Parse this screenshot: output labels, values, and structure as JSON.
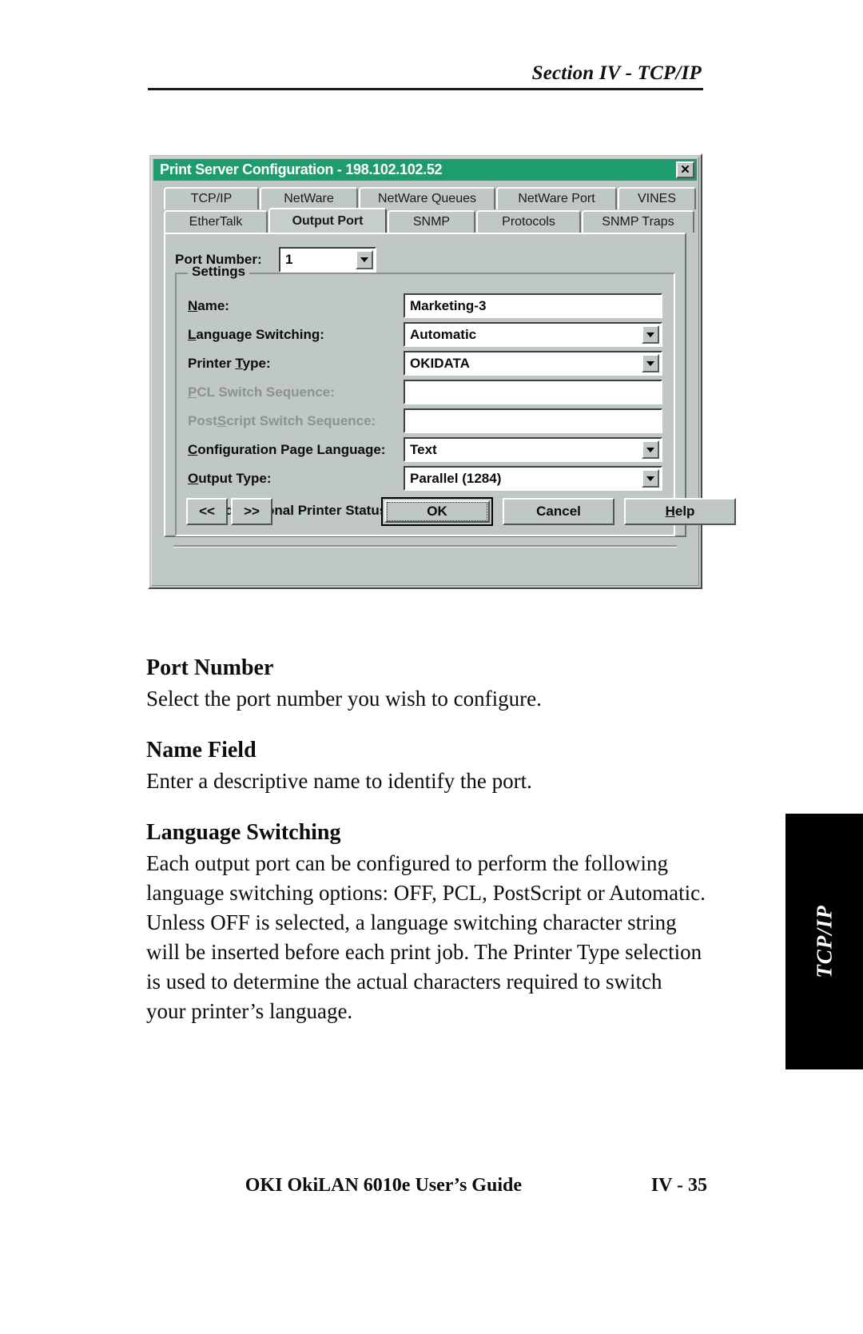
{
  "header": {
    "section": "Section IV - TCP/IP"
  },
  "dialog": {
    "title": "Print Server Configuration - 198.102.102.52",
    "close_label": "✕",
    "tabs_row1": [
      {
        "label": "TCP/IP",
        "active": false
      },
      {
        "label": "NetWare",
        "active": false
      },
      {
        "label": "NetWare Queues",
        "active": false
      },
      {
        "label": "NetWare Port",
        "active": false
      },
      {
        "label": "VINES",
        "active": false
      }
    ],
    "tabs_row2": [
      {
        "label": "EtherTalk",
        "active": false
      },
      {
        "label": "Output Port",
        "active": true
      },
      {
        "label": "SNMP",
        "active": false
      },
      {
        "label": "Protocols",
        "active": false
      },
      {
        "label": "SNMP Traps",
        "active": false
      }
    ],
    "port_number": {
      "label_pre": "Port ",
      "label_key": "N",
      "label_post": "umber:",
      "value": "1"
    },
    "settings_legend": "Settings",
    "fields": [
      {
        "label_pre": "",
        "label_key": "N",
        "label_post": "ame:",
        "value": "Marketing-3",
        "type": "text",
        "disabled": false
      },
      {
        "label_pre": "",
        "label_key": "L",
        "label_post": "anguage Switching:",
        "value": "Automatic",
        "type": "combo",
        "disabled": false
      },
      {
        "label_pre": "Printer ",
        "label_key": "T",
        "label_post": "ype:",
        "value": "OKIDATA",
        "type": "combo",
        "disabled": false
      },
      {
        "label_pre": "",
        "label_key": "P",
        "label_post": "CL Switch Sequence:",
        "value": "",
        "type": "text",
        "disabled": true
      },
      {
        "label_pre": "Post",
        "label_key": "S",
        "label_post": "cript Switch Sequence:",
        "value": "",
        "type": "text",
        "disabled": true
      },
      {
        "label_pre": "",
        "label_key": "C",
        "label_post": "onfiguration Page Language:",
        "value": "Text",
        "type": "combo",
        "disabled": false
      },
      {
        "label_pre": "",
        "label_key": "O",
        "label_post": "utput Type:",
        "value": "Parallel (1284)",
        "type": "combo",
        "disabled": false
      }
    ],
    "checkbox": {
      "checked": true,
      "mark": "✔",
      "label_pre": "",
      "label_key": "B",
      "label_post": "idirectional Printer Status Support"
    },
    "buttons": {
      "prev": "<<",
      "next": ">>",
      "ok": "OK",
      "cancel": "Cancel",
      "help_pre": "",
      "help_key": "H",
      "help_post": "elp"
    },
    "colors": {
      "titlebar": "#1f9c6e",
      "face": "#c0c8c4",
      "field": "#ffffff",
      "disabled_text": "#8c938f"
    }
  },
  "content": {
    "sections": [
      {
        "heading": "Port Number",
        "body": "Select the port number you wish to configure."
      },
      {
        "heading": "Name Field",
        "body": "Enter a descriptive name to identify the port."
      },
      {
        "heading": "Language Switching",
        "body": "Each output port can be configured to perform the following language switching options: OFF, PCL, PostScript or Automatic. Unless OFF is selected, a language switching character string will be inserted before each print job. The Printer Type selection is used to determine the actual characters required to switch your printer’s language."
      }
    ]
  },
  "side_tab": {
    "label": "TCP/IP"
  },
  "footer": {
    "guide": "OKI OkiLAN 6010e User’s Guide",
    "page": "IV - 35"
  }
}
